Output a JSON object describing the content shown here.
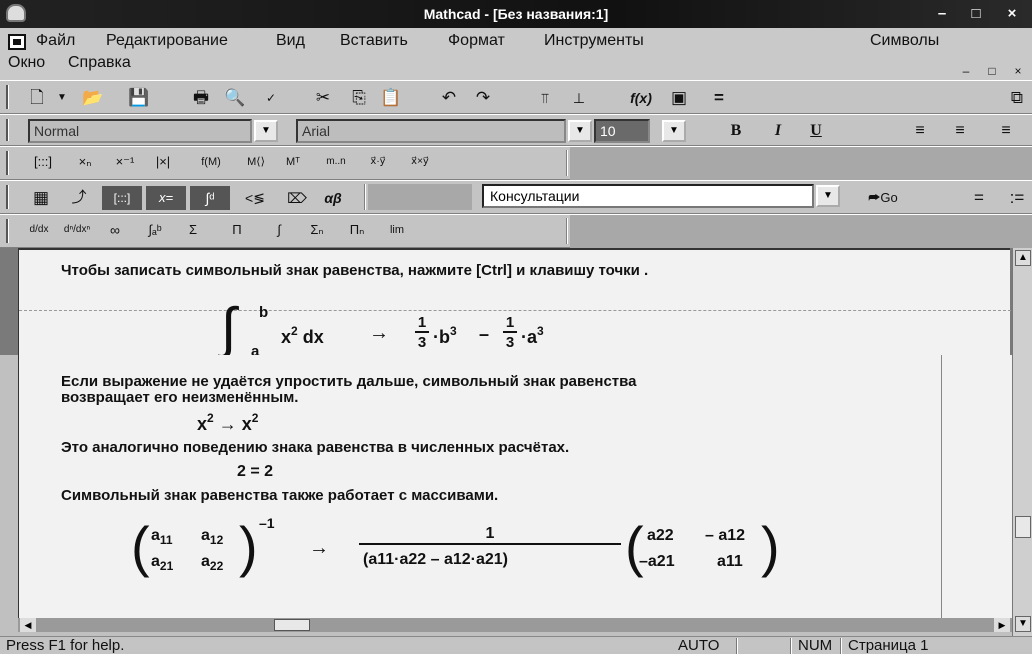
{
  "window": {
    "title": "Mathcad - [Без названия:1]",
    "minimize": "–",
    "maximize": "□",
    "close": "×"
  },
  "menu": {
    "items": [
      {
        "label": "Файл"
      },
      {
        "label": "Редактирование"
      },
      {
        "label": "Вид"
      },
      {
        "label": "Вставить"
      },
      {
        "label": "Формат"
      },
      {
        "label": "Инструменты"
      },
      {
        "label": "Символы"
      },
      {
        "label": "Окно"
      },
      {
        "label": "Справка"
      }
    ],
    "mdi_minimize": "–",
    "mdi_restore": "□",
    "mdi_close": "×"
  },
  "format": {
    "style": "Normal",
    "font": "Arial",
    "size": "10",
    "bold": "B",
    "italic": "I",
    "underline": "U"
  },
  "toolbar_matrix": [
    "[:::]",
    "×ₙ",
    "×⁻¹",
    "|×|",
    "f(M)",
    "M⟨⟩",
    "Mᵀ",
    "m..n",
    "x⃗·y⃗",
    "x⃗×y⃗"
  ],
  "toolbar_calculus": [
    "d/dx",
    "dⁿ/dxⁿ",
    "∞",
    "∫ₐᵇ",
    "Σ",
    "Π",
    "∫",
    "Σₙ",
    "Πₙ",
    "lim"
  ],
  "resources": {
    "value": "Консультации",
    "go": "Go"
  },
  "content": {
    "line1": "Чтобы записать символьный знак равенства, нажмите [Ctrl] и клавишу точки .",
    "eq1_b": "b",
    "eq1_a": "a",
    "eq1_main": "x",
    "eq1_pow": "2",
    "eq1_dx": "dx",
    "arrow": "→",
    "frac_num": "1",
    "frac_den": "3",
    "b_cube": "b",
    "a_cube": "a",
    "cube": "3",
    "minus": "–",
    "line2a": "Если выражение не удаётся упростить дальше, символьный знак равенства",
    "line2b": "возвращает его неизменённым.",
    "x2_left": "x",
    "x2_right": "x",
    "line3": "Это аналогично поведению знака равенства в численных расчётах.",
    "two_eq": "2 = 2",
    "line4": "Символьный знак равенства также работает с массивами.",
    "inv": "–1",
    "m_a11": "a",
    "m_a12": "a",
    "m_a21": "a",
    "m_a22": "a",
    "s11": "11",
    "s12": "12",
    "s21": "21",
    "s22": "22",
    "denominator": "(a11·a22 – a12·a21)",
    "r_a22": "a22",
    "r_ma12": "– a12",
    "r_ma21": "–a21",
    "r_a11": "a11"
  },
  "status": {
    "help": "Press F1 for help.",
    "auto": "AUTO",
    "num": "NUM",
    "page": "Страница 1"
  }
}
